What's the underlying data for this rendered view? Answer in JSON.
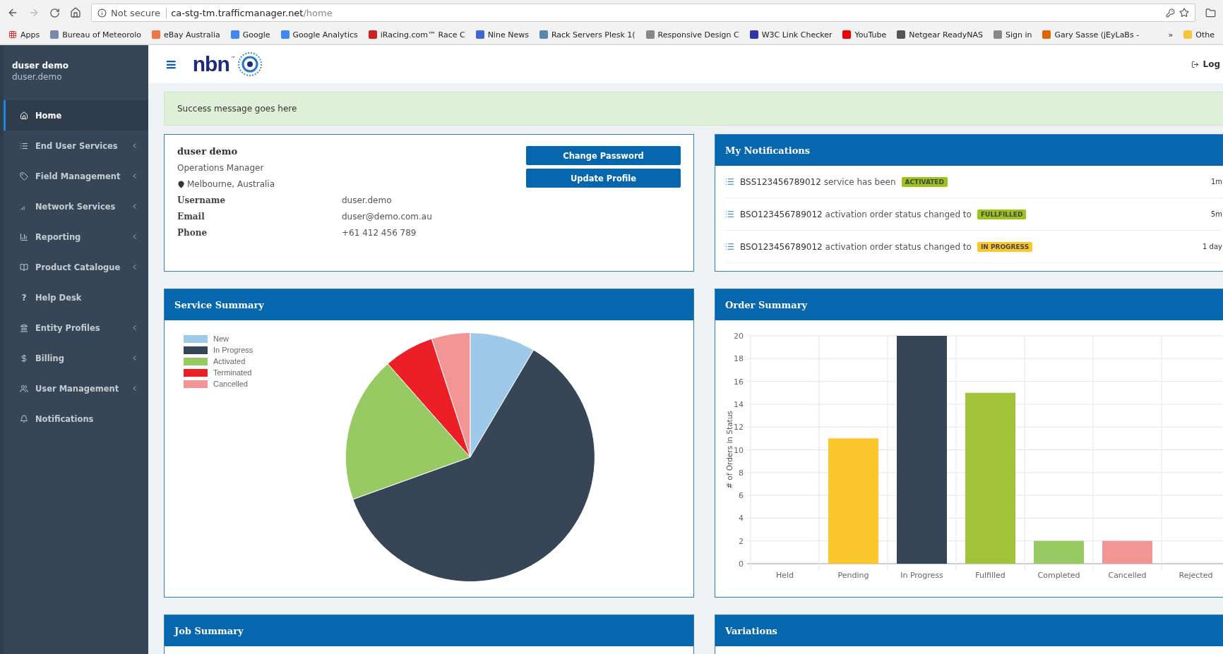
{
  "browser": {
    "security": "Not secure",
    "url_host": "ca-stg-tm.trafficmanager.net",
    "url_path": "/home",
    "bookmarks": [
      "Apps",
      "Bureau of Meteorolo",
      "eBay Australia",
      "Google",
      "Google Analytics",
      "iRacing.com™ Race C",
      "Nine News",
      "Rack Servers Plesk 1(",
      "Responsive Design C",
      "W3C Link Checker",
      "YouTube",
      "Netgear ReadyNAS",
      "Sign in",
      "Gary Sasse (jEyLaBs -"
    ],
    "more": "»",
    "other": "Othe"
  },
  "sidebar": {
    "user_name": "duser demo",
    "user_login": "duser.demo",
    "items": [
      {
        "label": "Home",
        "selected": true,
        "expandable": false
      },
      {
        "label": "End User Services",
        "selected": false,
        "expandable": true
      },
      {
        "label": "Field Management",
        "selected": false,
        "expandable": true
      },
      {
        "label": "Network Services",
        "selected": false,
        "expandable": true
      },
      {
        "label": "Reporting",
        "selected": false,
        "expandable": true
      },
      {
        "label": "Product Catalogue",
        "selected": false,
        "expandable": true
      },
      {
        "label": "Help Desk",
        "selected": false,
        "expandable": false,
        "icon_text": "?"
      },
      {
        "label": "Entity Profiles",
        "selected": false,
        "expandable": true
      },
      {
        "label": "Billing",
        "selected": false,
        "expandable": true
      },
      {
        "label": "User Management",
        "selected": false,
        "expandable": true
      },
      {
        "label": "Notifications",
        "selected": false,
        "expandable": false
      }
    ]
  },
  "topbar": {
    "menu": "≡",
    "logo": "nbn",
    "logo_mark": "™",
    "logout": "Log"
  },
  "alert": "Success message goes here",
  "profile": {
    "name": "duser demo",
    "role": "Operations Manager",
    "location": "Melbourne, Australia",
    "fields": [
      {
        "label": "Username",
        "value": "duser.demo"
      },
      {
        "label": "Email",
        "value": "duser@demo.com.au"
      },
      {
        "label": "Phone",
        "value": "+61 412 456 789"
      }
    ],
    "buttons": [
      "Change Password",
      "Update Profile"
    ]
  },
  "notifications": {
    "title": "My Notifications",
    "items": [
      {
        "id": "BSS123456789012",
        "text": "service has been",
        "status": "ACTIVATED",
        "color": "#9bc31c",
        "time": "1m"
      },
      {
        "id": "BSO123456789012",
        "text": "activation order status changed to",
        "status": "FULLFILLED",
        "color": "#9bc31c",
        "time": "5m"
      },
      {
        "id": "BSO123456789012",
        "text": "activation order status changed to",
        "status": "IN PROGRESS",
        "color": "#fcc72c",
        "time": "1 day"
      }
    ]
  },
  "service_summary": {
    "title": "Service Summary",
    "legend": [
      {
        "label": "New",
        "color": "#9fc9e8"
      },
      {
        "label": "In Progress",
        "color": "#364656"
      },
      {
        "label": "Activated",
        "color": "#98ca63"
      },
      {
        "label": "Terminated",
        "color": "#ec1f27"
      },
      {
        "label": "Cancelled",
        "color": "#f39595"
      }
    ]
  },
  "order_summary": {
    "title": "Order Summary",
    "chart_data": {
      "type": "bar",
      "ylabel": "# of Orders in Status",
      "categories": [
        "Held",
        "Pending",
        "In Progress",
        "Fulfilled",
        "Completed",
        "Cancelled",
        "Rejected"
      ],
      "series": [
        {
          "values": [
            0,
            11,
            20,
            15,
            2,
            2,
            0
          ],
          "colors": [
            "#cccccc",
            "#fcc72c",
            "#364656",
            "#a2c43a",
            "#98ca63",
            "#f39595",
            "#cccccc"
          ]
        }
      ],
      "ylim": [
        0,
        20
      ],
      "yticks": [
        0,
        2,
        4,
        6,
        8,
        10,
        12,
        14,
        16,
        18,
        20
      ],
      "grid": true
    }
  },
  "job_summary": {
    "title": "Job Summary"
  },
  "variations": {
    "title": "Variations"
  }
}
